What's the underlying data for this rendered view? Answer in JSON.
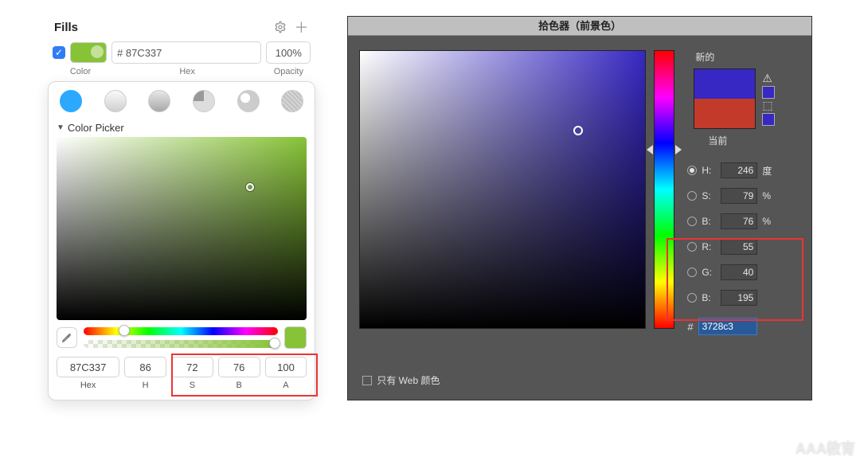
{
  "sketch": {
    "section_title": "Fills",
    "labels": {
      "color": "Color",
      "hex": "Hex",
      "opacity": "Opacity"
    },
    "fill": {
      "enabled": true,
      "swatch_hex": "87C337",
      "hex_value": "# 87C337",
      "opacity_value": "100%"
    },
    "picker_title": "Color Picker",
    "fields": {
      "hex": {
        "value": "87C337",
        "label": "Hex"
      },
      "h": {
        "value": "86",
        "label": "H"
      },
      "s": {
        "value": "72",
        "label": "S"
      },
      "b": {
        "value": "76",
        "label": "B"
      },
      "a": {
        "value": "100",
        "label": "A"
      }
    }
  },
  "photoshop": {
    "title": "拾色器（前景色）",
    "new_label": "新的",
    "current_label": "当前",
    "web_only": "只有 Web 颜色",
    "hsb": {
      "h": {
        "label": "H:",
        "value": "246",
        "unit": "度"
      },
      "s": {
        "label": "S:",
        "value": "79",
        "unit": "%"
      },
      "b": {
        "label": "B:",
        "value": "76",
        "unit": "%"
      }
    },
    "rgb": {
      "r": {
        "label": "R:",
        "value": "55"
      },
      "g": {
        "label": "G:",
        "value": "40"
      },
      "b": {
        "label": "B:",
        "value": "195"
      }
    },
    "hex": {
      "label": "#",
      "value": "3728c3"
    },
    "colors": {
      "new_hex": "#3728c3",
      "current_hex": "#c33a2a"
    }
  },
  "watermark": "AAA教育"
}
